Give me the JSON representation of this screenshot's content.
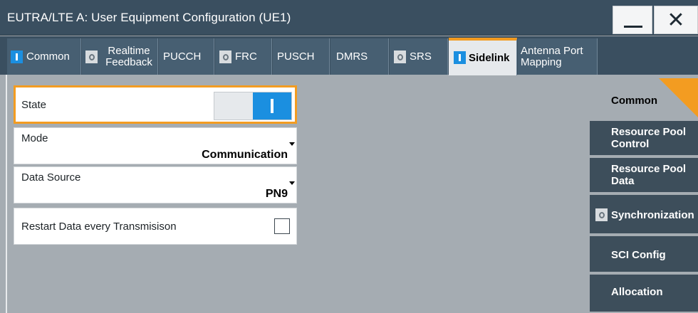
{
  "window": {
    "title": "EUTRA/LTE A: User Equipment Configuration (UE1)",
    "minimize_label": "minimize",
    "close_glyph": "✕"
  },
  "tabs": [
    {
      "id": "common",
      "label": "Common",
      "indicator": "on",
      "active": false
    },
    {
      "id": "realtime-feedback",
      "label": "Realtime Feedback",
      "indicator": "off",
      "active": false
    },
    {
      "id": "pucch",
      "label": "PUCCH",
      "indicator": "none",
      "active": false
    },
    {
      "id": "frc",
      "label": "FRC",
      "indicator": "off",
      "active": false
    },
    {
      "id": "pusch",
      "label": "PUSCH",
      "indicator": "none",
      "active": false
    },
    {
      "id": "dmrs",
      "label": "DMRS",
      "indicator": "none",
      "active": false
    },
    {
      "id": "srs",
      "label": "SRS",
      "indicator": "off",
      "active": false
    },
    {
      "id": "sidelink",
      "label": "Sidelink",
      "indicator": "on",
      "active": true
    },
    {
      "id": "antenna-port-mapping",
      "label": "Antenna Port Mapping",
      "indicator": "none",
      "active": false
    }
  ],
  "params": {
    "state": {
      "label": "State",
      "value": "on"
    },
    "mode": {
      "label": "Mode",
      "value": "Communication"
    },
    "data_source": {
      "label": "Data Source",
      "value": "PN9"
    },
    "restart": {
      "label": "Restart Data every Transmisison",
      "checked": false
    }
  },
  "side_nav": [
    {
      "id": "common",
      "label": "Common",
      "current": true
    },
    {
      "id": "resource-pool-control",
      "label": "Resource Pool Control"
    },
    {
      "id": "resource-pool-data",
      "label": "Resource Pool Data"
    },
    {
      "id": "synchronization",
      "label": "Synchronization",
      "indicator": "off"
    },
    {
      "id": "sci-config",
      "label": "SCI Config"
    },
    {
      "id": "allocation",
      "label": "Allocation"
    }
  ],
  "colors": {
    "accent": "#f39c21",
    "on_blue": "#1b8fe0",
    "chrome": "#3a4f60",
    "panel": "#a5acb2"
  }
}
